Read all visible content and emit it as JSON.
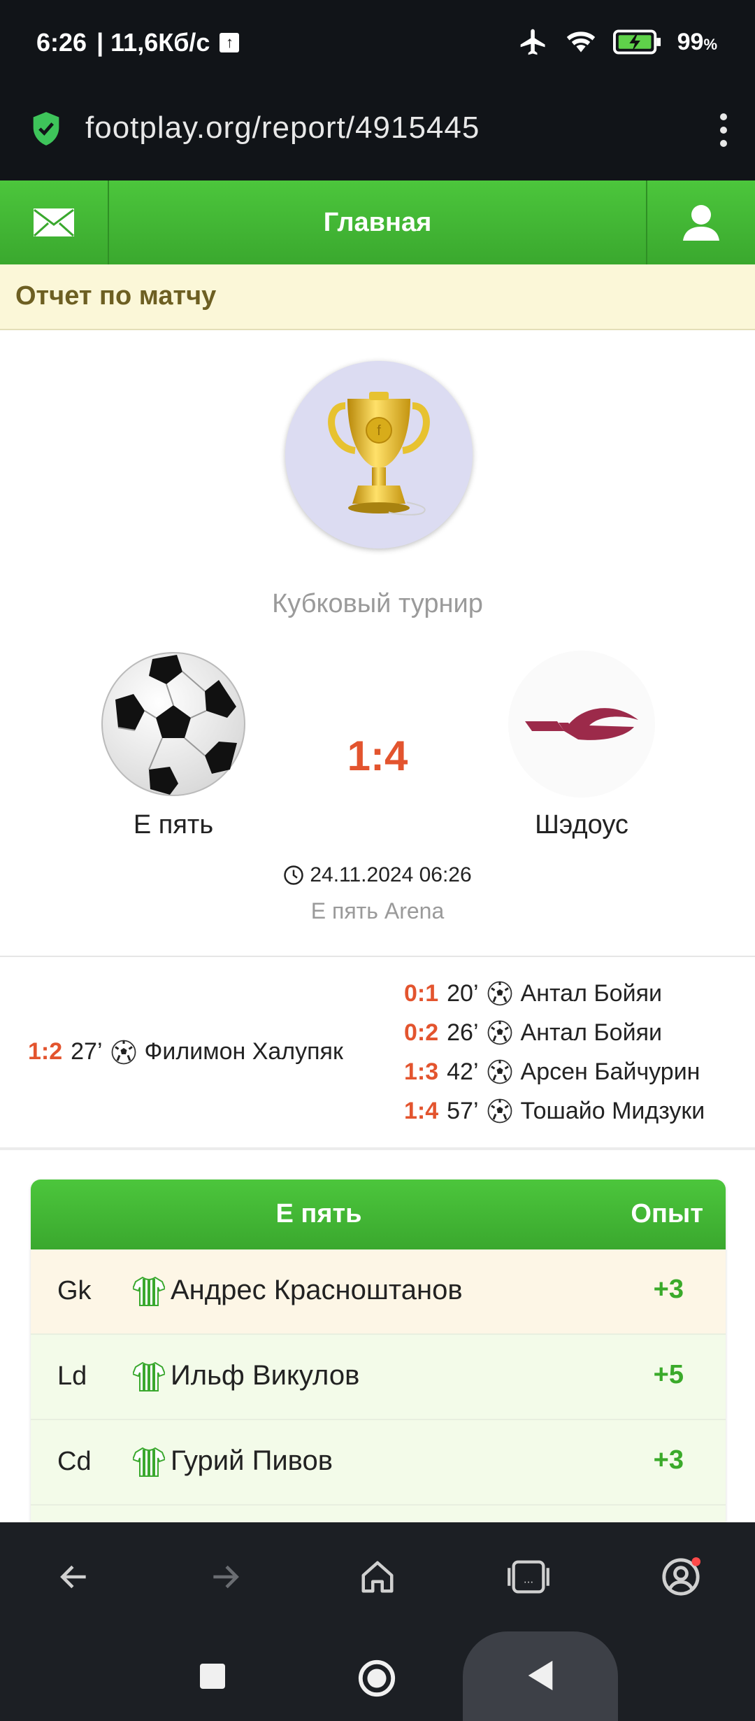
{
  "status_bar": {
    "time": "6:26",
    "speed": "| 11,6Кб/с",
    "battery": "99"
  },
  "browser": {
    "url": "footplay.org/report/4915445"
  },
  "nav": {
    "title": "Главная"
  },
  "page": {
    "heading": "Отчет по матчу"
  },
  "match": {
    "tournament": "Кубковый турнир",
    "home_team": "Е пять",
    "away_team": "Шэдоус",
    "score": "1:4",
    "datetime": "24.11.2024 06:26",
    "stadium": "Е пять Arena"
  },
  "goals": {
    "home": [
      {
        "score": "1:2",
        "minute": "27’",
        "player": "Филимон Халупяк"
      }
    ],
    "away": [
      {
        "score": "0:1",
        "minute": "20’",
        "player": "Антал Бойяи"
      },
      {
        "score": "0:2",
        "minute": "26’",
        "player": "Антал Бойяи"
      },
      {
        "score": "1:3",
        "minute": "42’",
        "player": "Арсен Байчурин"
      },
      {
        "score": "1:4",
        "minute": "57’",
        "player": "Тошайо Мидзуки"
      }
    ]
  },
  "players_table": {
    "team_header": "Е пять",
    "exp_header": "Опыт",
    "rows": [
      {
        "pos": "Gk",
        "name": "Андрес Красноштанов",
        "exp": "+3"
      },
      {
        "pos": "Ld",
        "name": "Ильф Викулов",
        "exp": "+5"
      },
      {
        "pos": "Cd",
        "name": "Гурий Пивов",
        "exp": "+3"
      }
    ]
  },
  "colors": {
    "accent_green": "#3aa82e",
    "score_red": "#e3542e",
    "exp_green": "#3aaa2a"
  }
}
